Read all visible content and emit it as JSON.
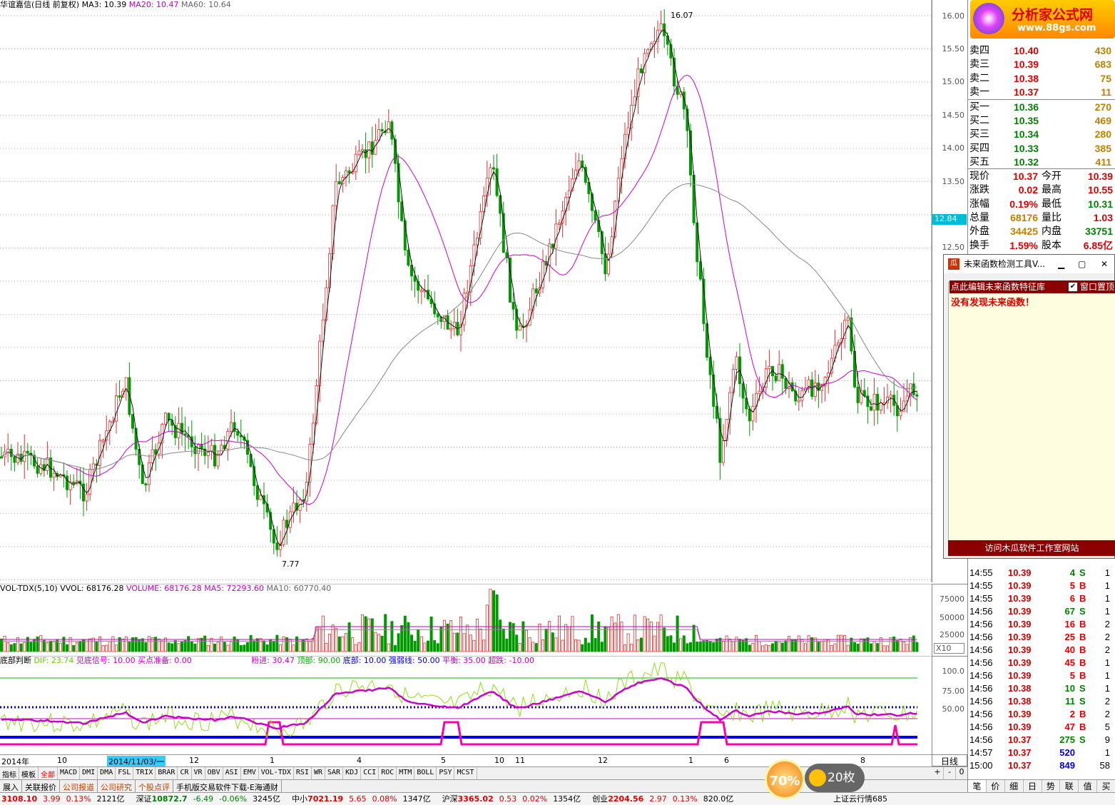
{
  "main": {
    "title": "华谊嘉信(日线 前复权)",
    "ma3": "MA3: 10.39",
    "ma20": "MA20: 10.47",
    "ma60": "MA60: 10.64",
    "high_label": "16.07",
    "low_label": "7.77",
    "current_price_tag": "12.84",
    "price_axis": [
      "16.00",
      "15.50",
      "15.00",
      "14.50",
      "14.00",
      "13.50",
      "12.50"
    ]
  },
  "volume": {
    "name": "VOL-TDX(5,10)",
    "vvol": "VVOL: 68176.28",
    "volume": "VOLUME: 68176.28",
    "ma5": "MA5: 72293.60",
    "ma10": "MA10: 60770.40",
    "axis": [
      "75000",
      "50000",
      "25000"
    ],
    "unit": "X10"
  },
  "indicator": {
    "name": "底部判断",
    "dif": "DIF: 23.74",
    "signal": "见底信号: 10.00",
    "buy_prep": "买点准备: 0.00",
    "pink_in": "粉进: 30.47",
    "top": "顶部: 90.00",
    "bottom": "底部: 10.00",
    "strong_weak": "强弱线: 50.00",
    "balance": "平衡: 35.00",
    "oversold": "超跌: -10.00",
    "axis": [
      "100.0",
      "75.00",
      "50.00"
    ]
  },
  "dates": [
    "2014年",
    "10",
    "2014/11/03/一",
    "12",
    "1",
    "4",
    "5",
    "10",
    "11",
    "12",
    "1",
    "6",
    "8"
  ],
  "period": "日线",
  "indicator_tabs": [
    "指标",
    "模板",
    "全部",
    "MACD",
    "DMI",
    "DMA",
    "FSL",
    "TRIX",
    "BRAR",
    "CR",
    "VR",
    "OBV",
    "ASI",
    "EMV",
    "VOL-TDX",
    "RSI",
    "WR",
    "SAR",
    "KDJ",
    "CCI",
    "ROC",
    "MTM",
    "BOLL",
    "PSY",
    "MCST"
  ],
  "bottom_tabs": [
    "展入",
    "关联报价",
    "公司报道",
    "公司研究",
    "个股点评",
    "手机版交易软件下载-E海通财"
  ],
  "zoom": [
    "+",
    "-",
    "0"
  ],
  "status": [
    {
      "name": "",
      "value": "3108.10",
      "chg": "3.99",
      "pct": "0.13%",
      "amt": "2121亿"
    },
    {
      "name": "深证",
      "value": "10872.7",
      "chg": "-6.49",
      "pct": "-0.06%",
      "amt": "3245亿"
    },
    {
      "name": "中小",
      "value": "7021.19",
      "chg": "5.65",
      "pct": "0.08%",
      "amt": "1347亿"
    },
    {
      "name": "沪深",
      "value": "3365.02",
      "chg": "0.53",
      "pct": "0.02%",
      "amt": "1354亿"
    },
    {
      "name": "创业",
      "value": "2204.56",
      "chg": "2.97",
      "pct": "0.13%",
      "amt": "820.0亿"
    }
  ],
  "status_right": "上证云行情685",
  "logo": {
    "title": "分析家公式网",
    "url": "www.88gs.com"
  },
  "orderbook": [
    {
      "label": "卖四",
      "price": "10.40",
      "vol": "430"
    },
    {
      "label": "卖三",
      "price": "10.39",
      "vol": "683"
    },
    {
      "label": "卖二",
      "price": "10.38",
      "vol": "75"
    },
    {
      "label": "卖一",
      "price": "10.37",
      "vol": "11"
    },
    {
      "label": "买一",
      "price": "10.36",
      "vol": "270"
    },
    {
      "label": "买二",
      "price": "10.35",
      "vol": "469"
    },
    {
      "label": "买三",
      "price": "10.34",
      "vol": "280"
    },
    {
      "label": "买四",
      "price": "10.33",
      "vol": "385"
    },
    {
      "label": "买五",
      "price": "10.32",
      "vol": "411"
    }
  ],
  "quote": [
    {
      "l1": "现价",
      "v1": "10.37",
      "l2": "今开",
      "v2": "10.39"
    },
    {
      "l1": "涨跌",
      "v1": "0.02",
      "l2": "最高",
      "v2": "10.55"
    },
    {
      "l1": "涨幅",
      "v1": "0.19%",
      "l2": "最低",
      "v2": "10.31"
    },
    {
      "l1": "总量",
      "v1": "68176",
      "l2": "量比",
      "v2": "1.03"
    },
    {
      "l1": "外盘",
      "v1": "34425",
      "l2": "内盘",
      "v2": "33751"
    },
    {
      "l1": "换手",
      "v1": "1.59%",
      "l2": "股本",
      "v2": "6.85亿"
    }
  ],
  "ticks": [
    {
      "t": "14:55",
      "p": "10.39",
      "v": "4",
      "s": "S",
      "n": "1"
    },
    {
      "t": "14:55",
      "p": "10.39",
      "v": "5",
      "s": "B",
      "n": "1"
    },
    {
      "t": "14:55",
      "p": "10.39",
      "v": "6",
      "s": "B",
      "n": "1"
    },
    {
      "t": "14:56",
      "p": "10.39",
      "v": "67",
      "s": "S",
      "n": "1"
    },
    {
      "t": "14:56",
      "p": "10.39",
      "v": "16",
      "s": "B",
      "n": "2"
    },
    {
      "t": "14:56",
      "p": "10.39",
      "v": "25",
      "s": "B",
      "n": "2"
    },
    {
      "t": "14:56",
      "p": "10.39",
      "v": "40",
      "s": "B",
      "n": "2"
    },
    {
      "t": "14:56",
      "p": "10.39",
      "v": "45",
      "s": "B",
      "n": "1"
    },
    {
      "t": "14:56",
      "p": "10.39",
      "v": "5",
      "s": "B",
      "n": "1"
    },
    {
      "t": "14:56",
      "p": "10.38",
      "v": "10",
      "s": "S",
      "n": "1"
    },
    {
      "t": "14:56",
      "p": "10.38",
      "v": "11",
      "s": "S",
      "n": "2"
    },
    {
      "t": "14:56",
      "p": "10.39",
      "v": "2",
      "s": "B",
      "n": "2"
    },
    {
      "t": "14:56",
      "p": "10.39",
      "v": "47",
      "s": "B",
      "n": "5"
    },
    {
      "t": "14:56",
      "p": "10.37",
      "v": "275",
      "s": "S",
      "n": "9"
    },
    {
      "t": "14:57",
      "p": "10.37",
      "v": "520",
      "s": "",
      "n": "1"
    },
    {
      "t": "15:00",
      "p": "10.37",
      "v": "849",
      "s": "",
      "n": "58"
    }
  ],
  "right_tabs": [
    "笔",
    "价",
    "细",
    "日",
    "势",
    "联",
    "值",
    "买"
  ],
  "popup": {
    "title": "未来函数检测工具V...",
    "link": "点此编辑未来函数特征库",
    "checkbox": "窗口置顶",
    "message": "没有发现未来函数！",
    "footer": "访问木瓜软件工作室网站"
  },
  "badges": {
    "pct": "70%",
    "count": "20枚"
  }
}
